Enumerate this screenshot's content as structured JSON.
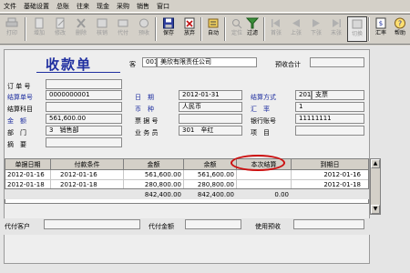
{
  "menu": [
    "文件",
    "基础设置",
    "总账",
    "往来",
    "现金",
    "采购",
    "销售",
    "窗口"
  ],
  "toolbar": [
    {
      "label": "打印",
      "icon": "printer-icon",
      "state": "disabled"
    },
    {
      "label": "增加",
      "icon": "add-doc-icon",
      "state": "disabled"
    },
    {
      "label": "修改",
      "icon": "edit-doc-icon",
      "state": "disabled"
    },
    {
      "label": "删除",
      "icon": "delete-icon",
      "state": "disabled"
    },
    {
      "label": "核销",
      "icon": "verify-icon",
      "state": "disabled"
    },
    {
      "label": "代付",
      "icon": "payment-icon",
      "state": "disabled"
    },
    {
      "label": "预收",
      "icon": "prepay-icon",
      "state": "disabled"
    },
    {
      "label": "保存",
      "icon": "save-icon",
      "state": "enabled"
    },
    {
      "label": "放弃",
      "icon": "discard-icon",
      "state": "enabled"
    },
    {
      "label": "自动",
      "icon": "auto-icon",
      "state": "enabled"
    },
    {
      "label": "定位",
      "icon": "locate-icon",
      "state": "disabled"
    },
    {
      "label": "过滤",
      "icon": "filter-icon",
      "state": "enabled"
    },
    {
      "label": "首张",
      "icon": "first-icon",
      "state": "disabled"
    },
    {
      "label": "上张",
      "icon": "prev-icon",
      "state": "disabled"
    },
    {
      "label": "下张",
      "icon": "next-icon",
      "state": "disabled"
    },
    {
      "label": "末张",
      "icon": "last-icon",
      "state": "disabled"
    },
    {
      "label": "切换",
      "icon": "switch-icon",
      "state": "active"
    },
    {
      "label": "汇率",
      "icon": "rate-icon",
      "state": "enabled"
    },
    {
      "label": "帮助",
      "icon": "help-icon",
      "state": "enabled"
    }
  ],
  "form": {
    "title": "收款单",
    "customer_label": "客　户",
    "customer_code": "001",
    "customer_name": "美欣有限责任公司",
    "prepay_total_label": "预收合计",
    "order_label": "订 单 号",
    "voucher_no_label": "结算单号",
    "voucher_no": "0000000001",
    "date_label": "日　期",
    "date": "2012-01-31",
    "settle_method_label": "结算方式",
    "settle_method_code": "201",
    "settle_method_name": "支票",
    "settle_subject_label": "结算科目",
    "currency_label": "币　种",
    "currency": "人民币",
    "rate_label": "汇　率",
    "rate": "1",
    "amount_label": "金　额",
    "amount": "561,600.00",
    "bill_no_label": "票 据 号",
    "bank_account_label": "银行账号",
    "bank_account": "11111111",
    "dept_label": "部　门",
    "dept": "3　销售部",
    "salesman_label": "业 务 员",
    "salesman": "301　辛红",
    "project_label": "项　目",
    "summary_label": "摘　要"
  },
  "grid": {
    "headers": [
      "单据日期",
      "付款条件",
      "金额",
      "余额",
      "本次结算",
      "到期日"
    ],
    "rows": [
      [
        "2012-01-16",
        "2012-01-16",
        "561,600.00",
        "561,600.00",
        "",
        "2012-01-16"
      ],
      [
        "2012-01-18",
        "2012-01-18",
        "280,800.00",
        "280,800.00",
        "",
        "2012-01-18"
      ]
    ],
    "totals": {
      "amount": "842,400.00",
      "balance": "842,400.00",
      "settle": "0.00"
    }
  },
  "bottom": {
    "agent_customer_label": "代付客户",
    "agent_amount_label": "代付金额",
    "use_prepay_label": "使用预收"
  }
}
